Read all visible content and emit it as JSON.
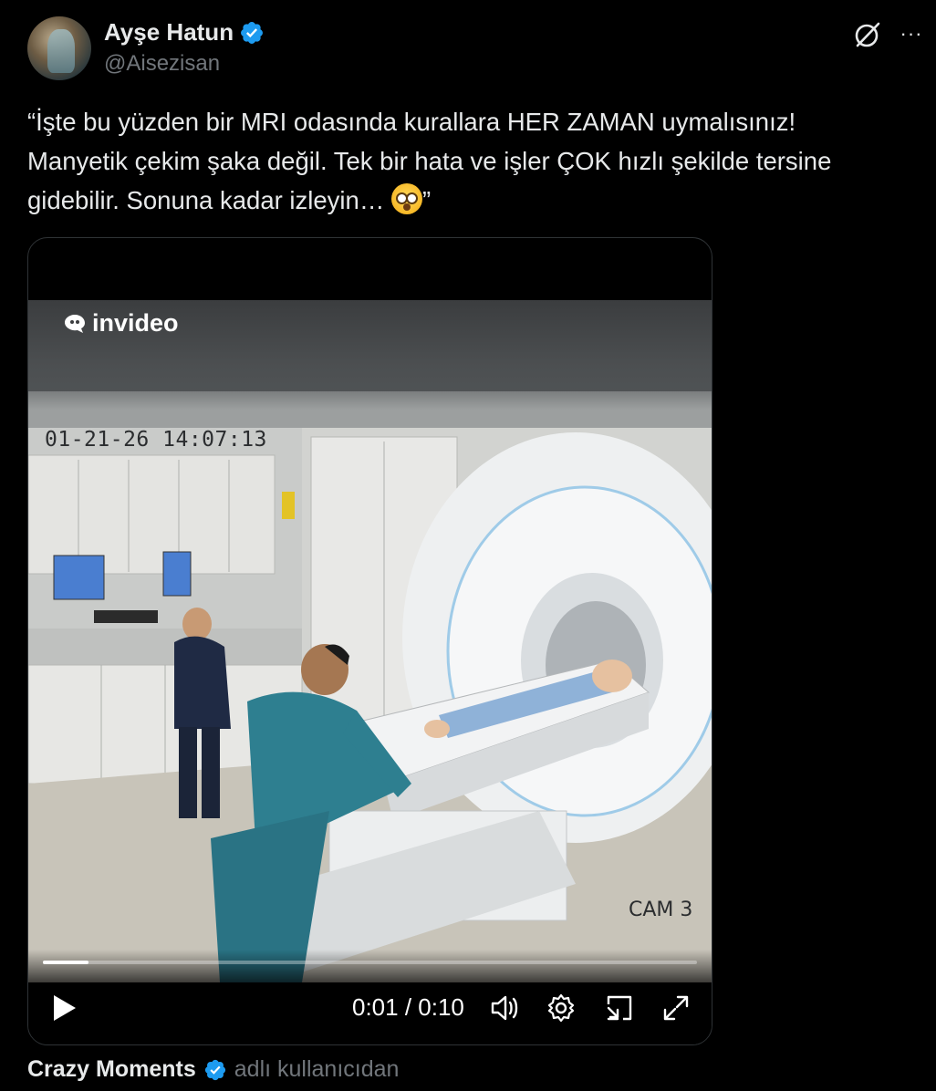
{
  "author": {
    "display_name": "Ayşe Hatun",
    "handle": "@Aisezisan",
    "verified": true
  },
  "header_actions": {
    "grok_icon": "grok-slash-circle-icon",
    "more_icon": "more-horizontal-icon",
    "more_glyph": "···"
  },
  "tweet": {
    "text_line1": "“İşte bu yüzden bir MRI odasında kurallara HER ZAMAN uymalısınız!",
    "text_line2": "Manyetik çekim şaka değil. Tek bir hata ve işler ÇOK hızlı şekilde tersine",
    "text_line3": "gidebilir. Sonuna kadar izleyin…",
    "emoji_name": "flushed-face",
    "closing_quote": "”"
  },
  "video": {
    "watermark": "invideo",
    "timestamp_overlay": "01-21-26 14:07:13",
    "camera_label": "CAM 3",
    "current_time": "0:01",
    "duration": "0:10",
    "time_display": "0:01 / 0:10",
    "progress_fraction": 0.07,
    "controls": [
      "play-icon",
      "volume-icon",
      "settings-icon",
      "picture-in-picture-icon",
      "fullscreen-icon"
    ]
  },
  "attribution": {
    "name": "Crazy Moments",
    "suffix": "adlı kullanıcıdan",
    "verified": true
  },
  "colors": {
    "background": "#000000",
    "text_primary": "#e7e9ea",
    "text_secondary": "#71767b",
    "verified_blue": "#1d9bf0",
    "border": "#2f3336"
  }
}
